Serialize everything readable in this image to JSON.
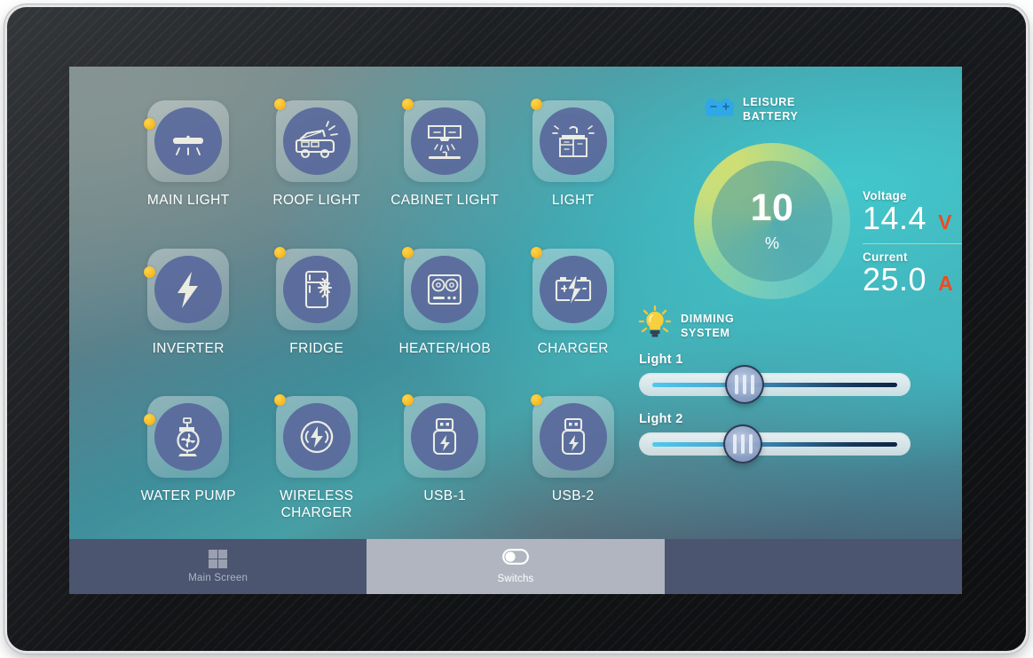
{
  "screen": {
    "tiles": [
      {
        "label": "MAIN LIGHT",
        "icon": "ceiling-light-icon",
        "status_dot": true
      },
      {
        "label": "ROOF LIGHT",
        "icon": "campervan-icon",
        "status_dot": true
      },
      {
        "label": "CABINET LIGHT",
        "icon": "cabinet-light-icon",
        "status_dot": true
      },
      {
        "label": "LIGHT",
        "icon": "sink-light-icon",
        "status_dot": true
      },
      {
        "label": "INVERTER",
        "icon": "lightning-bolt-icon",
        "status_dot": true
      },
      {
        "label": "FRIDGE",
        "icon": "fridge-icon",
        "status_dot": true
      },
      {
        "label": "HEATER/HOB",
        "icon": "hob-icon",
        "status_dot": true
      },
      {
        "label": "CHARGER",
        "icon": "battery-charge-icon",
        "status_dot": true
      },
      {
        "label": "WATER PUMP",
        "icon": "water-pump-icon",
        "status_dot": true
      },
      {
        "label": "WIRELESS\nCHARGER",
        "icon": "wireless-charge-icon",
        "status_dot": true
      },
      {
        "label": "USB-1",
        "icon": "usb-icon",
        "status_dot": true
      },
      {
        "label": "USB-2",
        "icon": "usb-icon",
        "status_dot": true
      }
    ],
    "battery": {
      "heading": "LEISURE\nBATTERY",
      "icon": "battery-icon",
      "charge_value": "10",
      "charge_unit": "%",
      "voltage_label": "Voltage",
      "voltage_value": "14.4",
      "voltage_unit": "V",
      "current_label": "Current",
      "current_value": "25.0",
      "current_unit": "A"
    },
    "dimming": {
      "heading": "DIMMING\nSYSTEM",
      "icon": "light-bulb-icon",
      "sliders": [
        {
          "label": "Light 1",
          "percent": 37
        },
        {
          "label": "Light 2",
          "percent": 37
        }
      ]
    },
    "nav": [
      {
        "label": "Main Screen",
        "icon": "grid-icon",
        "active": false
      },
      {
        "label": "Switchs",
        "icon": "toggle-icon",
        "active": true
      }
    ],
    "colors": {
      "accent_red": "#f04a1e",
      "accent_yellow": "#f5bb27",
      "tile_circle": "#59699c",
      "nav_bar": "#4b5570",
      "nav_active": "#b0b5bf",
      "divider": "#d6c98a"
    }
  }
}
